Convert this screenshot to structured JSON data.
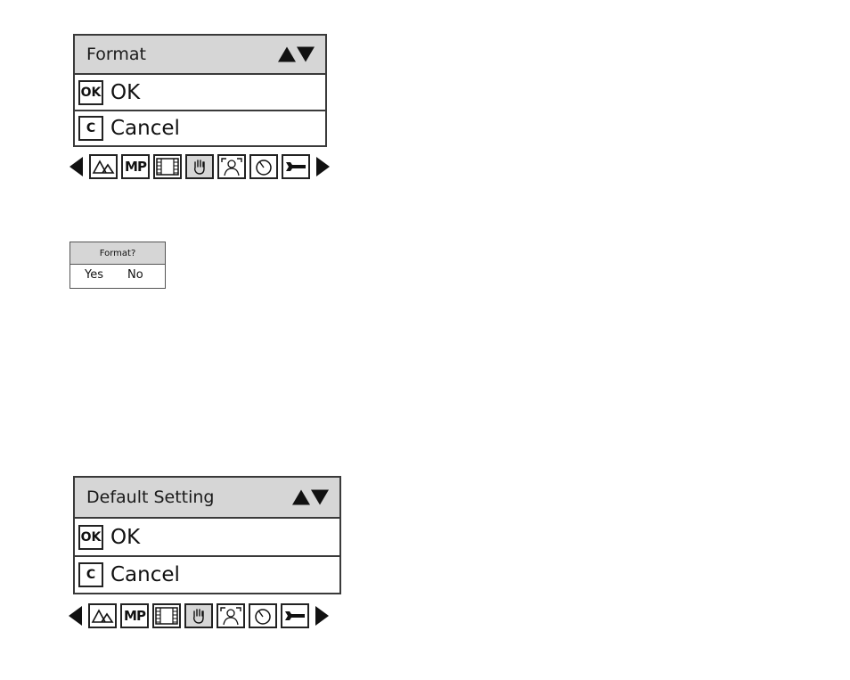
{
  "format_menu": {
    "title": "Format",
    "rows": [
      {
        "key": "OK",
        "label": "OK"
      },
      {
        "key": "C",
        "label": "Cancel"
      }
    ]
  },
  "format_dialog": {
    "title": "Format?",
    "yes": "Yes",
    "no": "No"
  },
  "default_menu": {
    "title": "Default Setting",
    "rows": [
      {
        "key": "OK",
        "label": "OK"
      },
      {
        "key": "C",
        "label": "Cancel"
      }
    ]
  },
  "icon_bar": {
    "icons": [
      "mountain-icon",
      "mp-icon",
      "film-icon",
      "hand-icon",
      "face-frame-icon",
      "timer-icon",
      "wrench-icon"
    ],
    "mp_label": "MP",
    "active": "hand-icon"
  }
}
